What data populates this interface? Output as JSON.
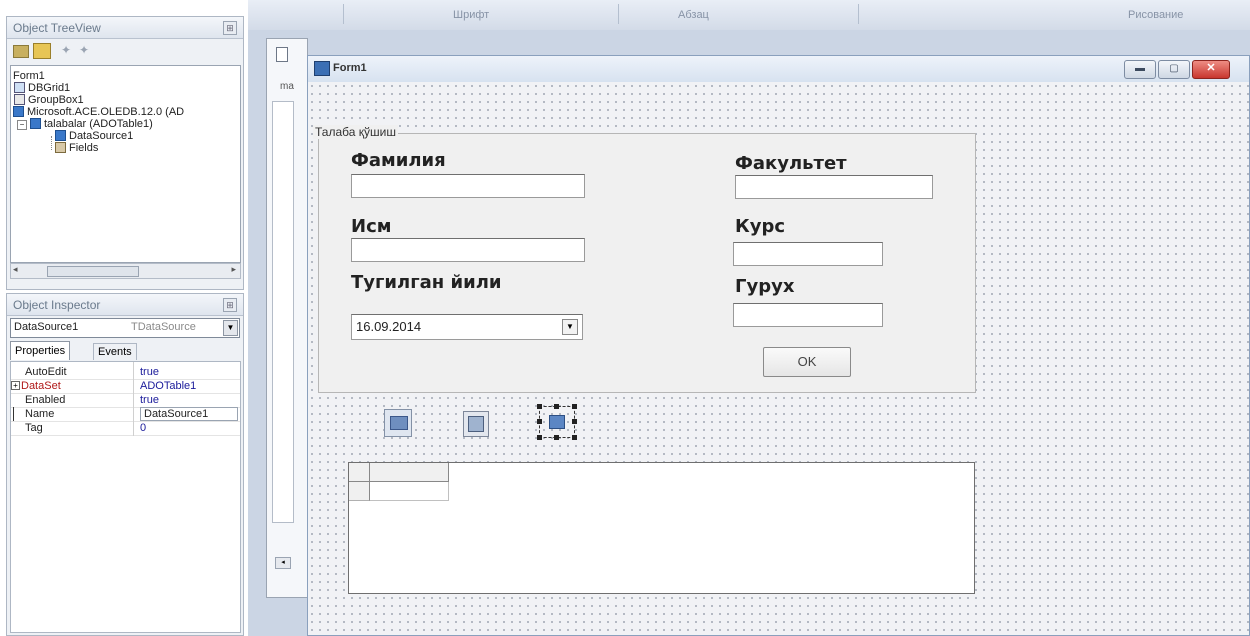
{
  "ribbon": {
    "groups": [
      "Шрифт",
      "Абзац",
      "Рисование"
    ]
  },
  "object_treeview": {
    "title": "Object TreeView",
    "items": [
      {
        "label": "Form1",
        "level": 0,
        "icon": "form-icon"
      },
      {
        "label": "DBGrid1",
        "level": 1,
        "icon": "dbgrid-icon"
      },
      {
        "label": "GroupBox1",
        "level": 1,
        "icon": "groupbox-icon"
      },
      {
        "label": "Microsoft.ACE.OLEDB.12.0 (AD",
        "level": 1,
        "icon": "connection-icon"
      },
      {
        "label": "talabalar (ADOTable1)",
        "level": 1,
        "icon": "table-icon"
      },
      {
        "label": "DataSource1",
        "level": 2,
        "icon": "datasource-icon"
      },
      {
        "label": "Fields",
        "level": 2,
        "icon": "fields-icon"
      }
    ]
  },
  "object_inspector": {
    "title": "Object Inspector",
    "selected_component": "DataSource1",
    "selected_type": "TDataSource",
    "tabs": [
      "Properties",
      "Events"
    ],
    "properties": [
      {
        "name": "AutoEdit",
        "value": "true"
      },
      {
        "name": "DataSet",
        "value": "ADOTable1",
        "expandable": true
      },
      {
        "name": "Enabled",
        "value": "true"
      },
      {
        "name": "Name",
        "value": "DataSource1",
        "selected": true
      },
      {
        "name": "Tag",
        "value": "0"
      }
    ]
  },
  "editor": {
    "tab_label": "ma"
  },
  "form": {
    "title": "Form1",
    "groupbox_caption": "Талаба қўшиш",
    "labels": {
      "familiya": "Фамилия",
      "ism": "Исм",
      "tugilgan": "Тугилган йили",
      "fakultet": "Факультет",
      "kurs": "Курс",
      "guruh": "Гурух"
    },
    "date_value": "16.09.2014",
    "ok_label": "OK"
  },
  "colors": {
    "form_title_bg": "#e3ecf7",
    "close_button": "#d9413a",
    "designer_bg": "#f1f2f5",
    "ide_bg": "#cbd5e4"
  }
}
